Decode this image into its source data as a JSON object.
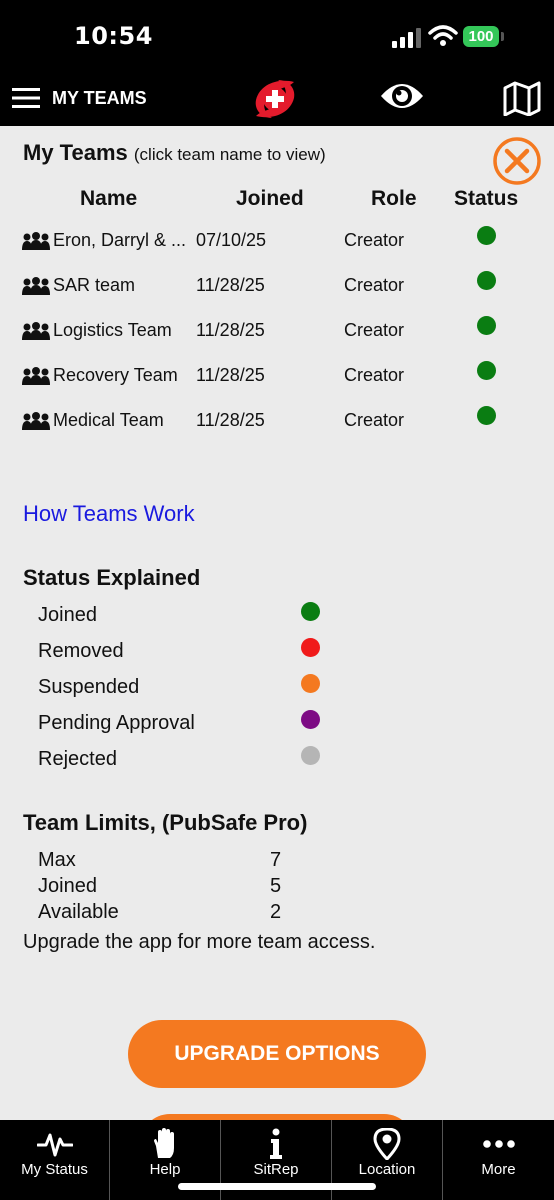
{
  "status_bar": {
    "time": "10:54",
    "battery": "100"
  },
  "nav": {
    "title": "MY TEAMS"
  },
  "header": {
    "title": "My Teams",
    "hint": "(click team name to view)"
  },
  "table": {
    "columns": [
      "Name",
      "Joined",
      "Role",
      "Status"
    ],
    "rows": [
      {
        "name": "Eron, Darryl & ...",
        "joined": "07/10/25",
        "role": "Creator",
        "status_color": "#0a7d12"
      },
      {
        "name": "SAR team",
        "joined": "11/28/25",
        "role": "Creator",
        "status_color": "#0a7d12"
      },
      {
        "name": "Logistics Team",
        "joined": "11/28/25",
        "role": "Creator",
        "status_color": "#0a7d12"
      },
      {
        "name": "Recovery Team",
        "joined": "11/28/25",
        "role": "Creator",
        "status_color": "#0a7d12"
      },
      {
        "name": "Medical Team",
        "joined": "11/28/25",
        "role": "Creator",
        "status_color": "#0a7d12"
      }
    ]
  },
  "how_link": "How Teams Work",
  "status_explained": {
    "title": "Status Explained",
    "items": [
      {
        "label": "Joined",
        "color": "#0a7d12"
      },
      {
        "label": "Removed",
        "color": "#f01a1a"
      },
      {
        "label": "Suspended",
        "color": "#f47920"
      },
      {
        "label": "Pending Approval",
        "color": "#7d0a84"
      },
      {
        "label": "Rejected",
        "color": "#b5b5b5"
      }
    ]
  },
  "limits": {
    "title": "Team Limits, (PubSafe Pro)",
    "rows": [
      {
        "label": "Max",
        "value": "7"
      },
      {
        "label": "Joined",
        "value": "5"
      },
      {
        "label": "Available",
        "value": "2"
      }
    ],
    "note": "Upgrade the app for more team access."
  },
  "upgrade_button": "UPGRADE OPTIONS",
  "tabs": [
    {
      "label": "My Status",
      "icon": "heartbeat-icon"
    },
    {
      "label": "Help",
      "icon": "hand-icon"
    },
    {
      "label": "SitRep",
      "icon": "info-icon"
    },
    {
      "label": "Location",
      "icon": "location-pin-icon"
    },
    {
      "label": "More",
      "icon": "more-dots-icon"
    }
  ],
  "colors": {
    "accent": "#f47920",
    "link": "#1a1adf",
    "bar": "#000000",
    "background": "#ebebeb"
  }
}
